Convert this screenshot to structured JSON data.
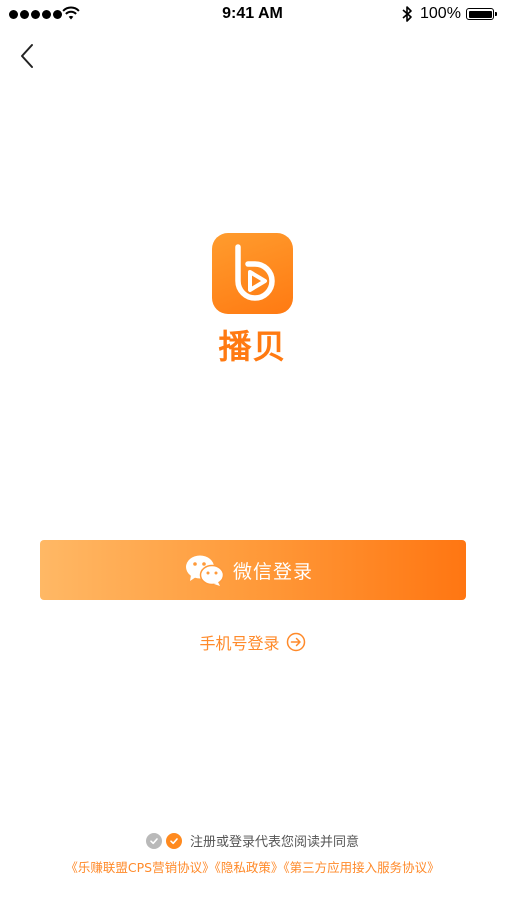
{
  "status_bar": {
    "time": "9:41 AM",
    "battery": "100%"
  },
  "icons": {
    "back": "chevron-left-icon",
    "logo": "play-b-logo-icon",
    "wechat": "wechat-icon",
    "arrow": "arrow-circle-right-icon",
    "check": "check-circle-icon"
  },
  "colors": {
    "brand": "#ff7a12",
    "link": "#ff8a2a",
    "check_inactive": "#b9b9b9"
  },
  "app": {
    "name": "播贝"
  },
  "login": {
    "wechat_label": "微信登录",
    "phone_label": "手机号登录"
  },
  "agreement": {
    "text": "注册或登录代表您阅读并同意",
    "links": [
      "《乐赚联盟CPS营销协议》",
      "《隐私政策》",
      "《第三方应用接入服务协议》"
    ]
  }
}
